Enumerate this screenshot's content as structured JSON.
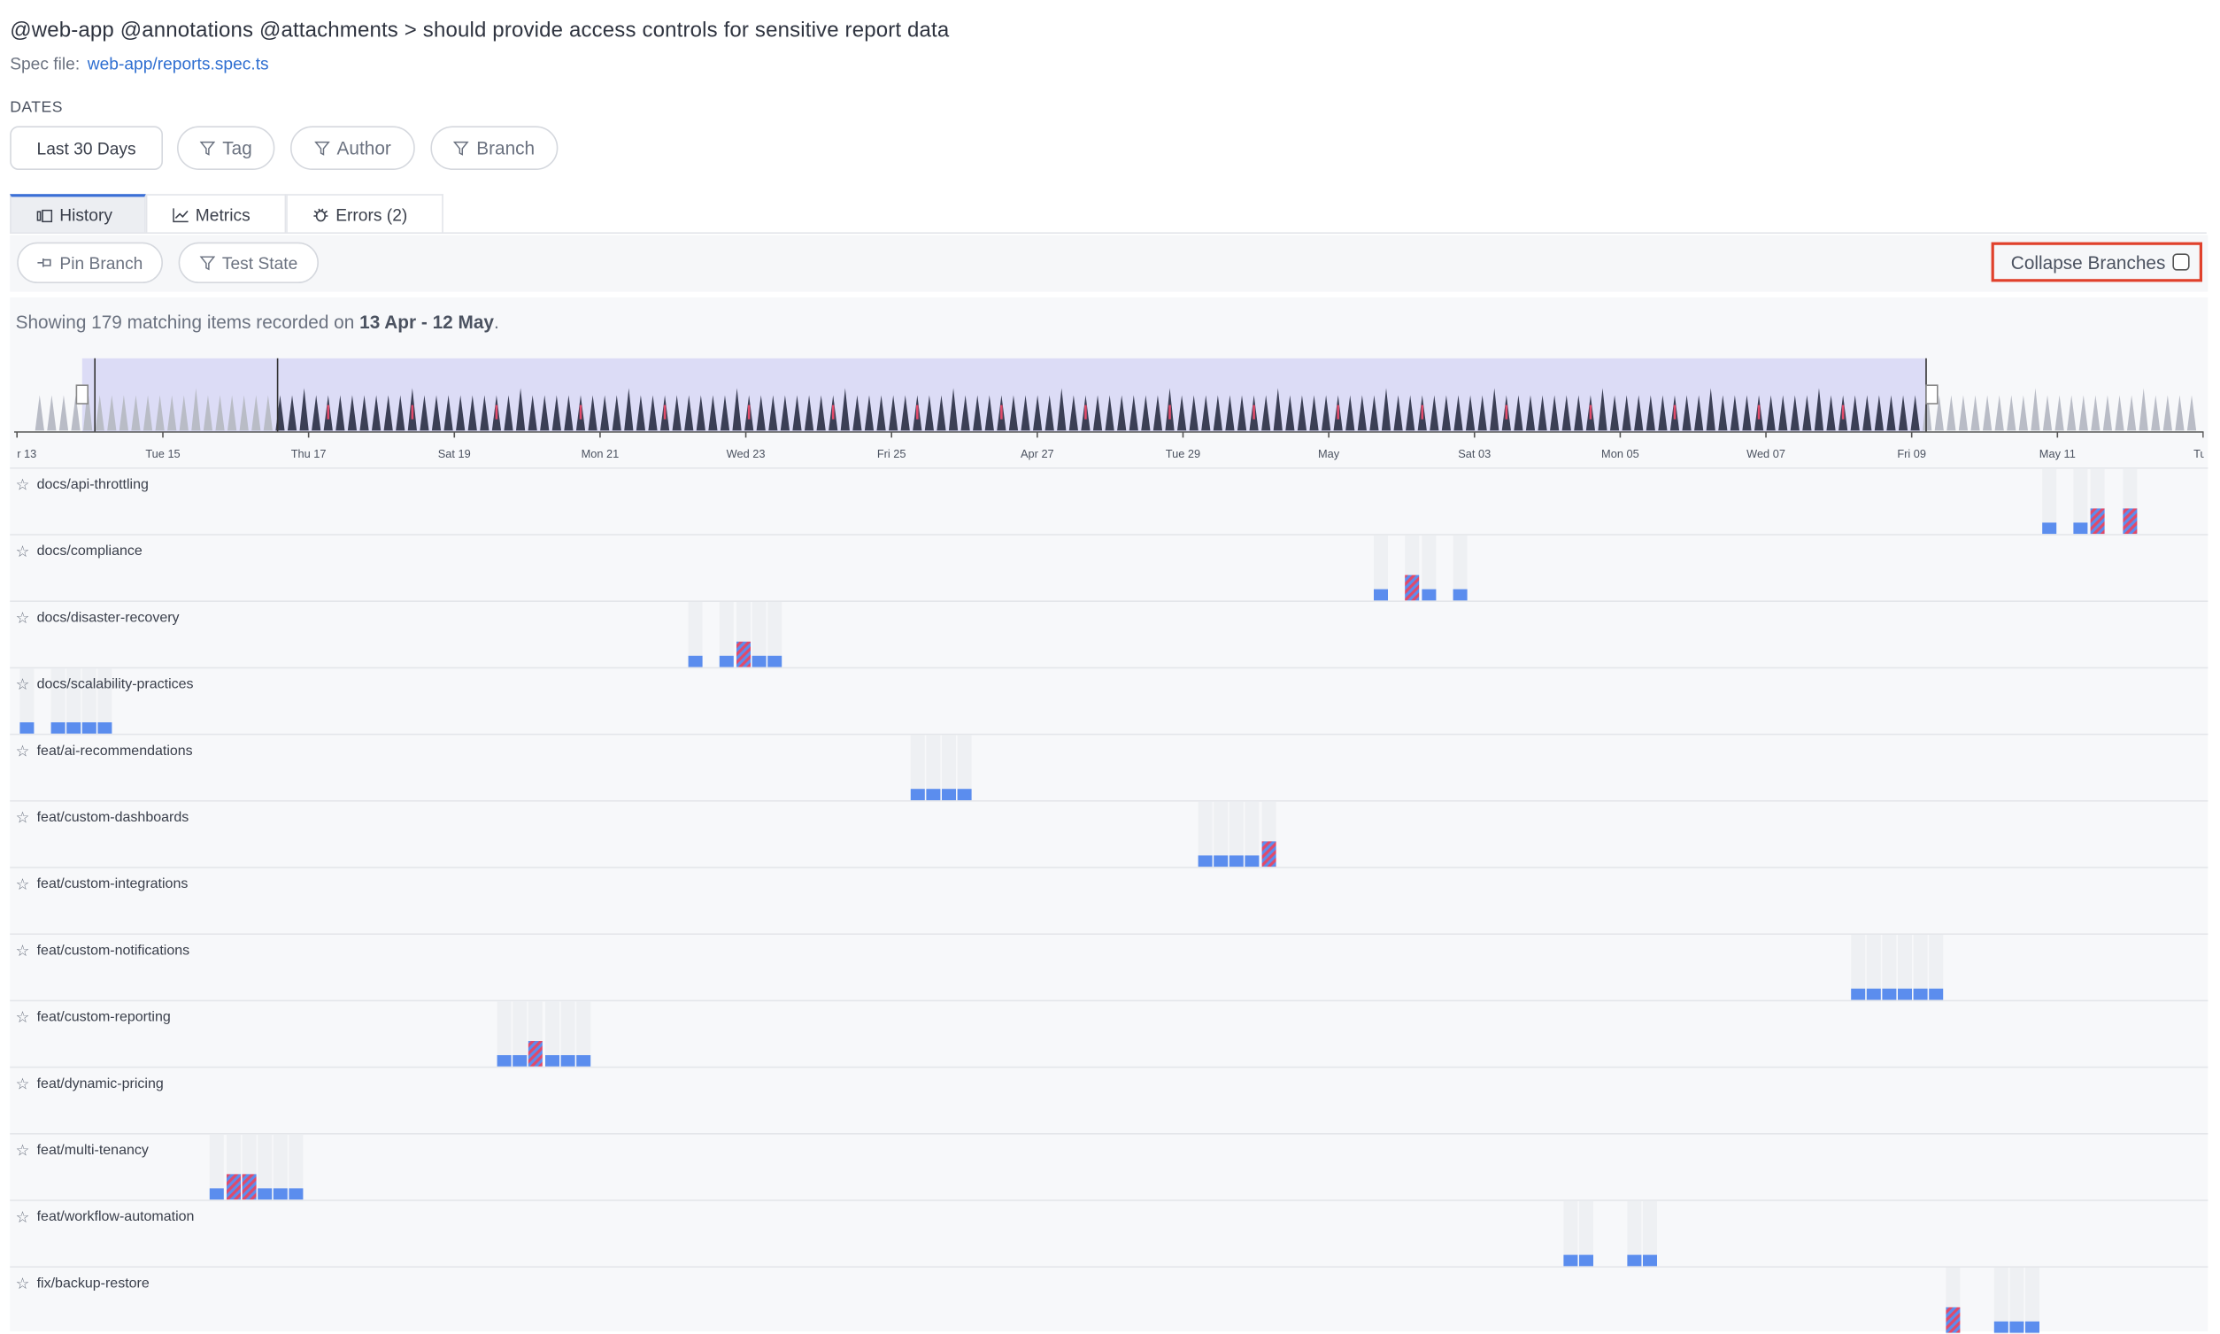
{
  "header": {
    "title": "@web-app @annotations @attachments > should provide access controls for sensitive report data",
    "spec_label": "Spec file:",
    "spec_link": "web-app/reports.spec.ts"
  },
  "filters": {
    "dates_label": "DATES",
    "date_range": "Last 30 Days",
    "tag": "Tag",
    "author": "Author",
    "branch": "Branch"
  },
  "tabs": [
    {
      "label": "History",
      "active": true
    },
    {
      "label": "Metrics",
      "active": false
    },
    {
      "label": "Errors (2)",
      "active": false
    }
  ],
  "toolbar": {
    "pin_branch": "Pin Branch",
    "test_state": "Test State",
    "collapse_branches": "Collapse Branches",
    "collapse_checked": false
  },
  "summary": {
    "prefix": "Showing 179 matching items recorded on",
    "range": "13 Apr - 12 May",
    "suffix": "."
  },
  "timeline": {
    "ticks": [
      "r 13",
      "Tue 15",
      "Thu 17",
      "Sat 19",
      "Mon 21",
      "Wed 23",
      "Fri 25",
      "Apr 27",
      "Tue 29",
      "May",
      "Sat 03",
      "Mon 05",
      "Wed 07",
      "Fri 09",
      "May 11",
      "Tue"
    ]
  },
  "colors": {
    "pass": "#5b8dee",
    "fail": "#e04a6a",
    "spike": "#3b3f55",
    "spike_faded": "#b9bcc6",
    "window": "#dcdcf6"
  },
  "lanes": [
    {
      "label": "docs/api-throttling",
      "bars": [
        [
          1435,
          1
        ],
        [
          1457,
          1
        ],
        [
          1469,
          2
        ],
        [
          1492,
          2
        ]
      ]
    },
    {
      "label": "docs/compliance",
      "bars": [
        [
          963,
          1
        ],
        [
          985,
          2
        ],
        [
          997,
          1
        ],
        [
          1019,
          1
        ]
      ]
    },
    {
      "label": "docs/disaster-recovery",
      "bars": [
        [
          479,
          1
        ],
        [
          501,
          1
        ],
        [
          513,
          2
        ],
        [
          524,
          1
        ],
        [
          535,
          1
        ]
      ]
    },
    {
      "label": "docs/scalability-practices",
      "bars": [
        [
          7,
          1
        ],
        [
          29,
          1
        ],
        [
          40,
          1
        ],
        [
          51,
          1
        ],
        [
          62,
          1
        ]
      ]
    },
    {
      "label": "feat/ai-recommendations",
      "bars": [
        [
          636,
          1
        ],
        [
          647,
          1
        ],
        [
          658,
          1
        ],
        [
          669,
          1
        ]
      ]
    },
    {
      "label": "feat/custom-dashboards",
      "bars": [
        [
          839,
          1
        ],
        [
          850,
          1
        ],
        [
          861,
          1
        ],
        [
          872,
          1
        ],
        [
          884,
          2
        ]
      ]
    },
    {
      "label": "feat/custom-integrations",
      "bars": []
    },
    {
      "label": "feat/custom-notifications",
      "bars": [
        [
          1300,
          1
        ],
        [
          1311,
          1
        ],
        [
          1322,
          1
        ],
        [
          1333,
          1
        ],
        [
          1344,
          1
        ],
        [
          1355,
          1
        ]
      ]
    },
    {
      "label": "feat/custom-reporting",
      "bars": [
        [
          344,
          1
        ],
        [
          355,
          1
        ],
        [
          366,
          2
        ],
        [
          378,
          1
        ],
        [
          389,
          1
        ],
        [
          400,
          1
        ]
      ]
    },
    {
      "label": "feat/dynamic-pricing",
      "bars": []
    },
    {
      "label": "feat/multi-tenancy",
      "bars": [
        [
          141,
          1
        ],
        [
          153,
          2
        ],
        [
          164,
          2
        ],
        [
          175,
          1
        ],
        [
          186,
          1
        ],
        [
          197,
          1
        ]
      ]
    },
    {
      "label": "feat/workflow-automation",
      "bars": [
        [
          1097,
          1
        ],
        [
          1108,
          1
        ],
        [
          1142,
          1
        ],
        [
          1153,
          1
        ]
      ]
    },
    {
      "label": "fix/backup-restore",
      "bars": [
        [
          1367,
          2
        ],
        [
          1401,
          1
        ],
        [
          1412,
          1
        ],
        [
          1423,
          1
        ]
      ]
    }
  ]
}
